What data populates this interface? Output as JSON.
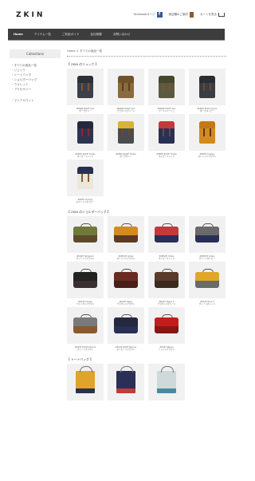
{
  "header": {
    "logo": "ZKIN",
    "links": [
      {
        "label": "Facebookページ",
        "icon": "facebook-icon"
      },
      {
        "label": "実店舗のご案内",
        "icon": "shop-icon"
      },
      {
        "label": "カートを見る",
        "icon": "cart-icon"
      }
    ]
  },
  "nav": {
    "items": [
      "Home",
      "アイテム一覧",
      "ご利用ガイド",
      "会社概要",
      "お問い合わせ"
    ]
  },
  "sidebar": {
    "title": "Collections",
    "items": [
      "リュック",
      "トートバッグ",
      "ショルダーバッグ",
      "ウォレット",
      "アクセサリー"
    ],
    "items_all_label": "すべての商品一覧",
    "extra": "マイアカウント"
  },
  "main": {
    "breadcrumb": "Home > すべての商品一覧",
    "sections": [
      {
        "title": "【 ZKIN のリュック 】",
        "items": [
          {
            "name": "ZKBKB ROOF Grit",
            "sub": "ダークグレー",
            "colors": [
              "#3a3f4a",
              "#2b2f36",
              "#7a5530"
            ]
          },
          {
            "name": "ZKBKB ROOF Grit",
            "sub": "ブラウン×グリーン",
            "colors": [
              "#8a6a3e",
              "#6f532c",
              "#5a4020"
            ]
          },
          {
            "name": "ZKBKB ROOF Grit",
            "sub": "カーキ×ベージュ",
            "colors": [
              "#5a5a40",
              "#47472f",
              "#7a5530"
            ]
          },
          {
            "name": "ZKB32 ECPV Duzzo",
            "sub": "ダークネイビー",
            "colors": [
              "#3a3d45",
              "#2b2d33",
              "#6b4a2b"
            ]
          },
          {
            "name": "ZKB35 ROOF Duzzo",
            "sub": "ネイビー×レッド",
            "colors": [
              "#2e3350",
              "#23283e",
              "#8a2a2a"
            ]
          },
          {
            "name": "ZKB35 ROOF Duzzo",
            "sub": "ダークグレー",
            "colors": [
              "#4a4c4f",
              "#d9b23a",
              "#6b4a2b"
            ]
          },
          {
            "name": "ZKB35 ROOF Duzzo",
            "sub": "ネイビー×レッド",
            "colors": [
              "#2a2f55",
              "#c23a3a",
              "#6b4a2b"
            ]
          },
          {
            "name": "ZKB35 Dumpo",
            "sub": "オレンジ×ブラウン",
            "colors": [
              "#d48a1e",
              "#c47a14",
              "#5a3a20"
            ]
          },
          {
            "name": "ZKB35 Dumpo",
            "sub": "ホワイト×ネイビー",
            "colors": [
              "#ece7da",
              "#2a3052",
              "#8a5a2e"
            ]
          }
        ]
      },
      {
        "title": "【 ZKIN のショルダーバッグ 】",
        "items": [
          {
            "name": "ZKS45 Templum",
            "sub": "グリーン×ブラウン",
            "colors": [
              "#6f7a3a",
              "#5e4a2a"
            ]
          },
          {
            "name": "ZKMS35 Odius",
            "sub": "オレンジ×ブラウン",
            "colors": [
              "#d48a1e",
              "#5a3a20"
            ]
          },
          {
            "name": "ZKMS35 Odius",
            "sub": "ネイビー×レッド",
            "colors": [
              "#c23a3a",
              "#2a2f55"
            ]
          },
          {
            "name": "ZKMS35 Odius",
            "sub": "グレー×ネイビー",
            "colors": [
              "#6a6a6a",
              "#2a2f55"
            ]
          },
          {
            "name": "ZKS45 Ondeo",
            "sub": "ブラック×ブラウン",
            "colors": [
              "#222222",
              "#3a3030"
            ]
          },
          {
            "name": "ZKS45 Rapio",
            "sub": "ブラウン×ブラウン",
            "colors": [
              "#6a2a22",
              "#4a1e18"
            ]
          },
          {
            "name": "ZKS45 Rapio F",
            "sub": "ブラウン×グリーン",
            "colors": [
              "#5a3a2a",
              "#3a2a20"
            ]
          },
          {
            "name": "ZKS45 Peru-F",
            "sub": "グレー×オレンジ",
            "colors": [
              "#e0a82a",
              "#6a6a6a"
            ]
          },
          {
            "name": "ZKS45 ROOF Remus",
            "sub": "グレー×ブラウン",
            "colors": [
              "#7a7a7a",
              "#8a5a2e"
            ]
          },
          {
            "name": "ZKS45 ROOF Remus",
            "sub": "ネイビー×ブラウン",
            "colors": [
              "#23283e",
              "#2a2f55"
            ]
          },
          {
            "name": "ZKS47 Nexus",
            "sub": "レッド×ブラウン",
            "colors": [
              "#c21e1e",
              "#8a1414"
            ]
          }
        ]
      },
      {
        "title": "【 トートバッグ 】",
        "items": [
          {
            "name": "",
            "sub": "",
            "colors": [
              "#e0a42a",
              "#2a3052"
            ]
          },
          {
            "name": "",
            "sub": "",
            "colors": [
              "#2a2f55",
              "#c23a3a"
            ]
          },
          {
            "name": "",
            "sub": "",
            "colors": [
              "#cfd9d9",
              "#4a8aa0"
            ]
          }
        ]
      }
    ]
  }
}
